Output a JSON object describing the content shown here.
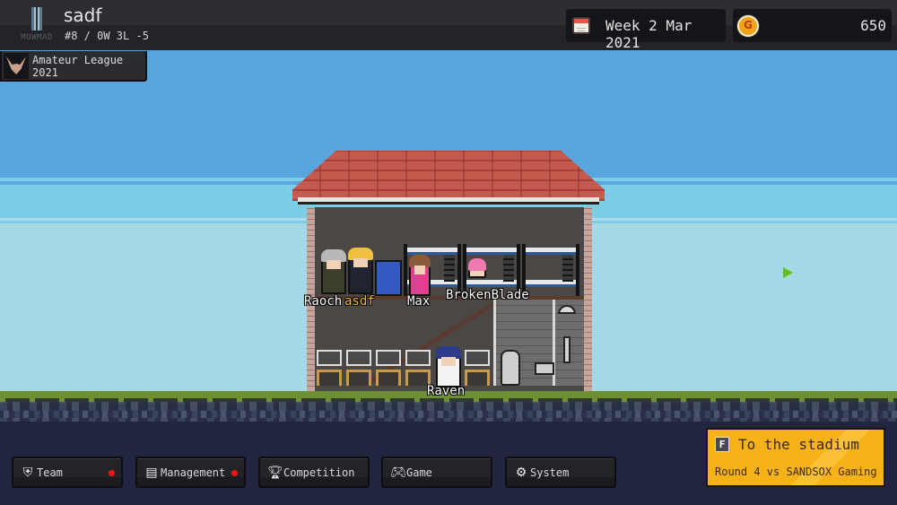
{
  "header": {
    "team_logo_text": "MOWMAD",
    "team_name": "sadf",
    "team_record": "#8 / 0W 3L -5",
    "league": {
      "line1": "Amateur League",
      "line2": "2021"
    },
    "date": "Week 2 Mar 2021",
    "gold": "650"
  },
  "house": {
    "characters": [
      {
        "name": "Raoch",
        "is_player": false
      },
      {
        "name": "asdf",
        "is_player": true
      },
      {
        "name": "Max",
        "is_player": false
      },
      {
        "name": "BrokenBlade",
        "is_player": false
      },
      {
        "name": "Raven",
        "is_player": false
      }
    ]
  },
  "nav": [
    {
      "label": "Team",
      "icon": "shield-icon",
      "notification": true
    },
    {
      "label": "Management",
      "icon": "document-icon",
      "notification": true
    },
    {
      "label": "Competition",
      "icon": "trophy-icon",
      "notification": false
    },
    {
      "label": "Game",
      "icon": "gamepad-icon",
      "notification": false
    },
    {
      "label": "System",
      "icon": "gear-icon",
      "notification": false
    }
  ],
  "stadium": {
    "hotkey": "F",
    "title": "To the stadium",
    "subtitle": "Round 4 vs SANDSOX Gaming"
  },
  "colors": {
    "accent": "#f7b21a",
    "notification": "#ff1010",
    "player_name": "#f2b53a",
    "sky": "#58a6dd",
    "grass": "#6e8f33"
  }
}
